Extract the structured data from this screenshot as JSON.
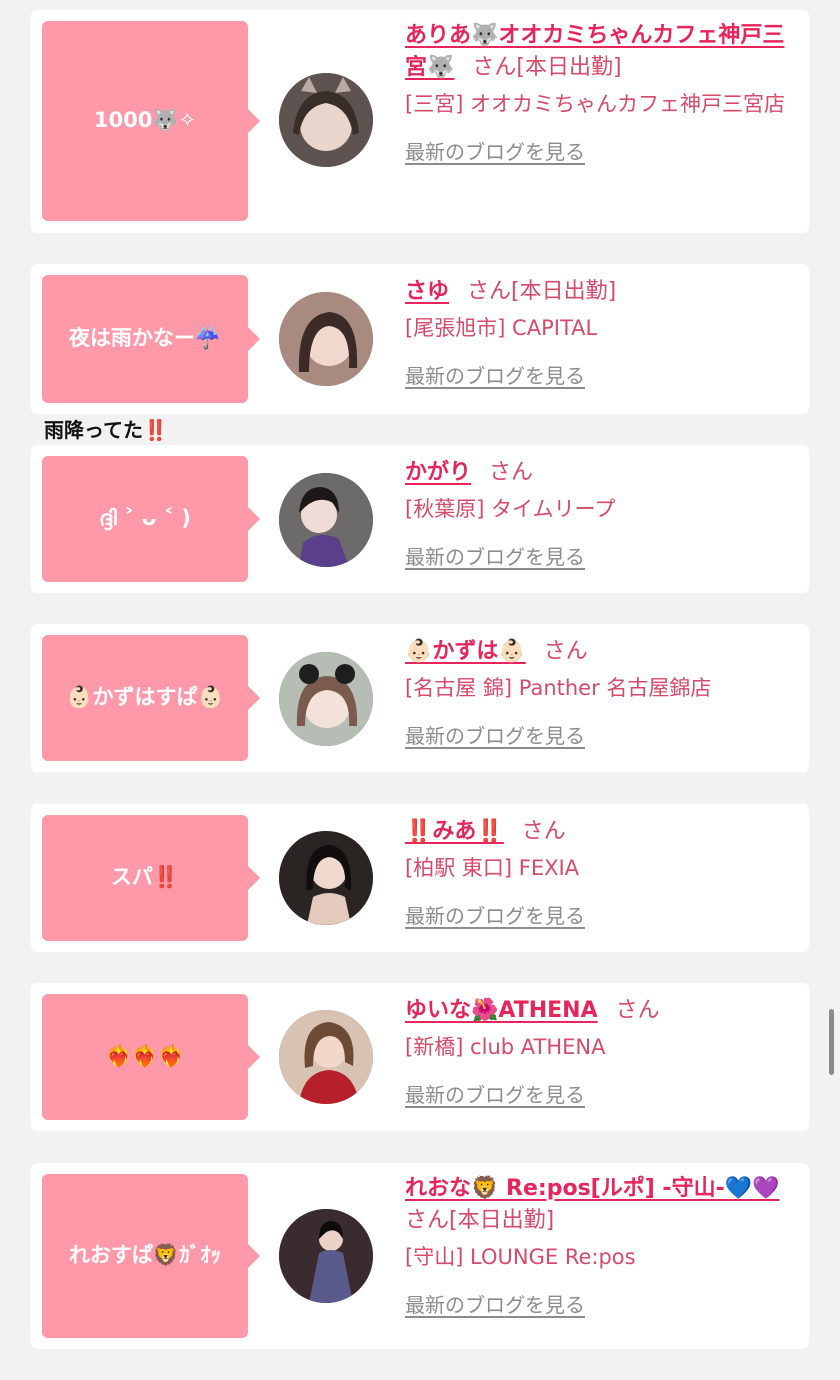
{
  "colors": {
    "bubble": "#ff99aa",
    "name": "#e8255a",
    "text": "#d64a6a",
    "blog_link": "#8c8c8c"
  },
  "note": "雨降ってた‼️",
  "cards": [
    {
      "bubble": "1000🐺﻿✧",
      "name": "ありあ🐺オオカミちゃんカフェ神戸三宮🐺",
      "san": "さん",
      "status": "[本日出勤]",
      "shop": "[三宮] オオカミちゃんカフェ神戸三宮店",
      "blog": "最新のブログを見る",
      "avatar_icon": "woman-portrait-icon"
    },
    {
      "bubble": "夜は雨かなー☔️",
      "name": "さゆ",
      "san": "さん",
      "status": "[本日出勤]",
      "shop": "[尾張旭市] CAPITAL",
      "blog": "最新のブログを見る",
      "avatar_icon": "woman-portrait-icon"
    },
    {
      "bubble": "ദ്ദി ˃ ᴗ ˂ )",
      "name": "かがり",
      "san": "さん",
      "status": "",
      "shop": "[秋葉原] タイムリープ",
      "blog": "最新のブログを見る",
      "avatar_icon": "woman-portrait-icon"
    },
    {
      "bubble": "👶🏻かずはすぱ👶🏻",
      "name": "👶🏻かずは👶🏻",
      "san": "さん",
      "status": "",
      "shop": "[名古屋 錦] Panther 名古屋錦店",
      "blog": "最新のブログを見る",
      "avatar_icon": "woman-portrait-icon"
    },
    {
      "bubble": "スパ‼️",
      "name": "‼️みあ‼️",
      "san": "さん",
      "status": "",
      "shop": "[柏駅 東口] FEXIA",
      "blog": "最新のブログを見る",
      "avatar_icon": "woman-portrait-icon"
    },
    {
      "bubble": "❤️‍🔥❤️‍🔥❤️‍🔥",
      "name": "ゆいな🌺ATHENA",
      "san": "さん",
      "status": "",
      "shop": "[新橋] club ATHENA",
      "blog": "最新のブログを見る",
      "avatar_icon": "woman-portrait-icon"
    },
    {
      "bubble": "れおすぱ🦁ｶﾞｵｯ",
      "name": "れおな🦁 Re:pos[ルポ] -守山-💙💜",
      "san": "さん",
      "status": "[本日出勤]",
      "shop": "[守山] LOUNGE Re:pos",
      "blog": "最新のブログを見る",
      "avatar_icon": "woman-portrait-icon"
    }
  ]
}
